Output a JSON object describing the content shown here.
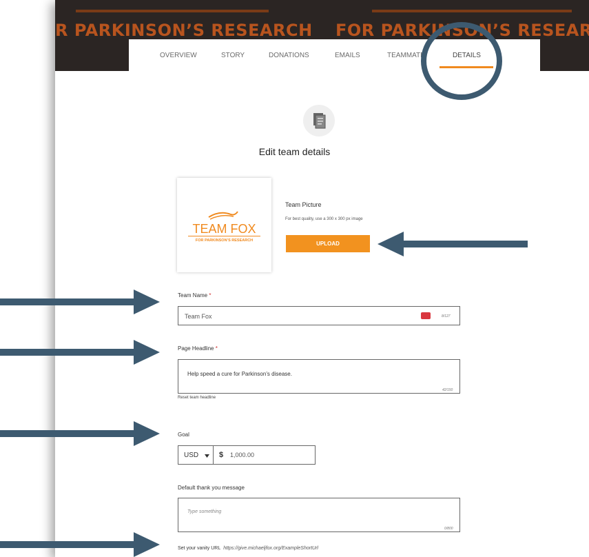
{
  "banner": {
    "left_text": "R PARKINSON’S RESEARCH",
    "right_text": "FOR PARKINSON’S RESEARCH"
  },
  "tabs": [
    {
      "label": "OVERVIEW"
    },
    {
      "label": "STORY"
    },
    {
      "label": "DONATIONS"
    },
    {
      "label": "EMAILS"
    },
    {
      "label": "TEAMMATE"
    },
    {
      "label": "DETAILS"
    }
  ],
  "main": {
    "title": "Edit team details"
  },
  "team_picture": {
    "logo_main": "TEAM FOX",
    "logo_sub": "FOR PARKINSON’S RESEARCH",
    "label": "Team Picture",
    "hint": "For best quality, use a 300 x 300 px image",
    "upload_label": "UPLOAD"
  },
  "form": {
    "team_name": {
      "label": "Team Name",
      "required_mark": "*",
      "value": "Team Fox",
      "count": "8/127"
    },
    "headline": {
      "label": "Page Headline",
      "required_mark": "*",
      "value": "Help speed a cure for Parkinson’s disease.",
      "count": "42/150",
      "reset_label": "Reset team headline"
    },
    "goal": {
      "label": "Goal",
      "currency": "USD",
      "currency_symbol": "$",
      "amount": "1,000.00"
    },
    "thank_you": {
      "label": "Default thank you message",
      "placeholder": "Type something",
      "count": "0/800"
    },
    "vanity": {
      "label": "Set your vanity URL",
      "example": "https://give.michaeljfox.org/ExampleShortUrl"
    }
  },
  "colors": {
    "accent": "#f2921f",
    "banner": "#2b2523",
    "annotation": "#3d5a70"
  }
}
